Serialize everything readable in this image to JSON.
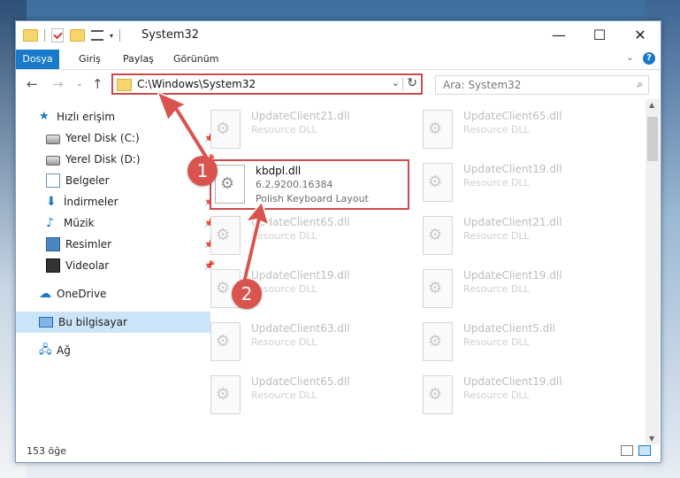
{
  "window": {
    "title": "System32"
  },
  "ribbon": {
    "tabs": [
      "Dosya",
      "Giriş",
      "Paylaş",
      "Görünüm"
    ]
  },
  "address": {
    "path": "C:\\Windows\\System32"
  },
  "search": {
    "placeholder": "Ara: System32"
  },
  "sidebar": {
    "items": [
      {
        "label": "Hızlı erişim",
        "icon": "star-icon"
      },
      {
        "label": "Yerel Disk (C:)",
        "icon": "disk-icon",
        "pinned": true
      },
      {
        "label": "Yerel Disk (D:)",
        "icon": "disk-icon",
        "pinned": true
      },
      {
        "label": "Belgeler",
        "icon": "document-icon",
        "pinned": true
      },
      {
        "label": "İndirmeler",
        "icon": "download-icon",
        "pinned": true
      },
      {
        "label": "Müzik",
        "icon": "music-icon",
        "pinned": true
      },
      {
        "label": "Resimler",
        "icon": "pictures-icon",
        "pinned": true
      },
      {
        "label": "Videolar",
        "icon": "videos-icon",
        "pinned": true
      },
      {
        "label": "OneDrive",
        "icon": "onedrive-icon"
      },
      {
        "label": "Bu bilgisayar",
        "icon": "computer-icon",
        "selected": true
      },
      {
        "label": "Ağ",
        "icon": "network-icon"
      }
    ]
  },
  "files": {
    "left": [
      {
        "name": "UpdateClient21.dll",
        "type": "Resource DLL"
      },
      {
        "name": "kbdpl.dll",
        "version": "6.2.9200.16384",
        "type": "Polish Keyboard Layout",
        "highlighted": true
      },
      {
        "name": "UpdateClient65.dll",
        "type": "Resource DLL"
      },
      {
        "name": "UpdateClient19.dll",
        "type": "Resource DLL"
      },
      {
        "name": "UpdateClient63.dll",
        "type": "Resource DLL"
      },
      {
        "name": "UpdateClient65.dll",
        "type": "Resource DLL"
      }
    ],
    "right": [
      {
        "name": "UpdateClient65.dll",
        "type": "Resource DLL"
      },
      {
        "name": "UpdateClient19.dll",
        "type": "Resource DLL"
      },
      {
        "name": "UpdateClient21.dll",
        "type": "Resource DLL"
      },
      {
        "name": "UpdateClient19.dll",
        "type": "Resource DLL"
      },
      {
        "name": "UpdateClient5.dll",
        "type": "Resource DLL"
      },
      {
        "name": "UpdateClient19.dll",
        "type": "Resource DLL"
      }
    ]
  },
  "status": {
    "count": "153 öğe"
  },
  "annotations": {
    "badge1": "1",
    "badge2": "2",
    "color": "#d9534f"
  }
}
